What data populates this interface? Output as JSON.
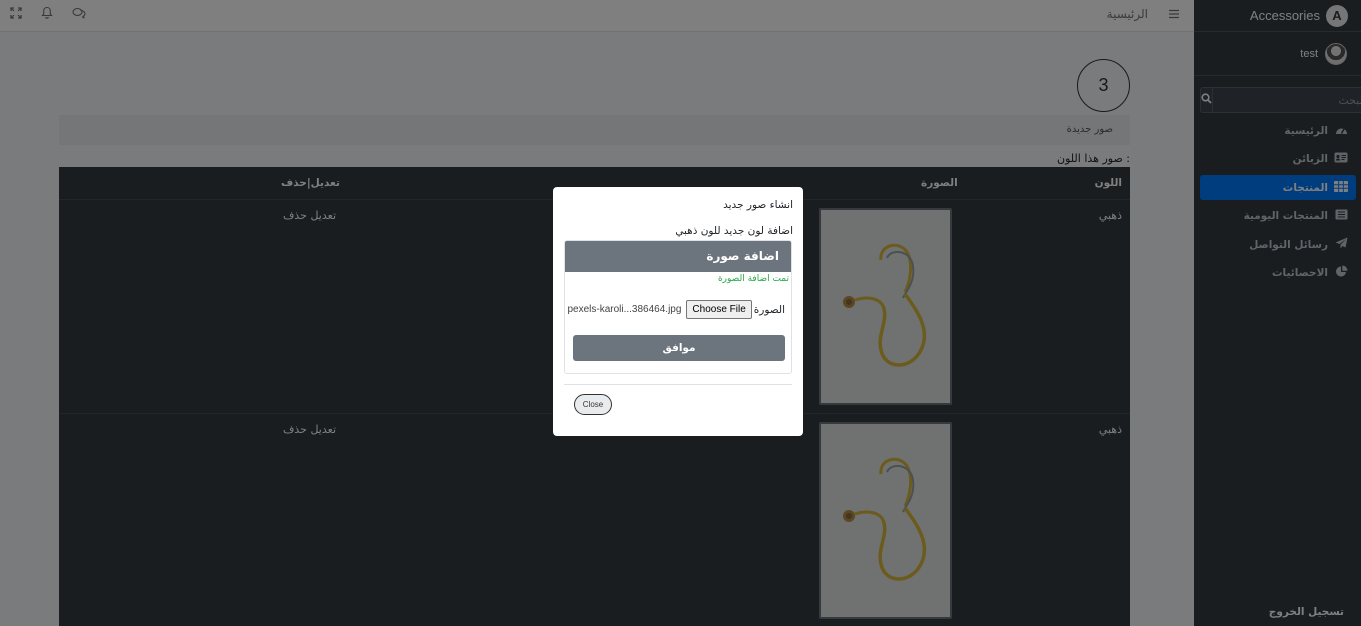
{
  "topbar": {
    "home_link": "الرئيسية",
    "icons": [
      "menu-icon",
      "chat-icon",
      "bell-icon",
      "expand-icon"
    ]
  },
  "sidebar": {
    "brand": "Accessories",
    "user": "test",
    "search_placeholder": "البحث",
    "items": [
      {
        "label": "الرئيسية",
        "icon": "dashboard-icon",
        "active": false
      },
      {
        "label": "الزبائن",
        "icon": "id-card-icon",
        "active": false
      },
      {
        "label": "المنتجات",
        "icon": "table-icon",
        "active": true
      },
      {
        "label": "المنتجات اليومية",
        "icon": "list-icon",
        "active": false
      },
      {
        "label": "رسائل التواصل",
        "icon": "paper-plane-icon",
        "active": false
      },
      {
        "label": "الاحصائيات",
        "icon": "pie-chart-icon",
        "active": false
      }
    ],
    "logout": "تسجيل الخروج"
  },
  "main": {
    "step_number": "3",
    "new_images_label": "صور جديدة",
    "color_images_label": "صور هذا اللون :",
    "table": {
      "headers": {
        "color": "اللون",
        "image": "الصورة",
        "actions": "تعديل|حذف"
      },
      "rows": [
        {
          "color": "ذهبي",
          "actions": "تعديل حذف"
        },
        {
          "color": "ذهبي",
          "actions": "تعديل حذف"
        }
      ]
    }
  },
  "modal": {
    "title": "انشاء صور جديد",
    "subtitle": "اضافة لون جديد للون ذهبي",
    "card_header": "اضافة صورة",
    "success_message": "تمت اضافة الصورة",
    "file_label": "الصورة",
    "file_button": "Choose File",
    "file_name": "pexels-karoli...386464.jpg",
    "submit_label": "موافق",
    "close_label": "Close"
  },
  "colors": {
    "sidebar_bg": "#343a40",
    "active": "#007bff",
    "success": "#28a745",
    "secondary": "#6c757d"
  }
}
